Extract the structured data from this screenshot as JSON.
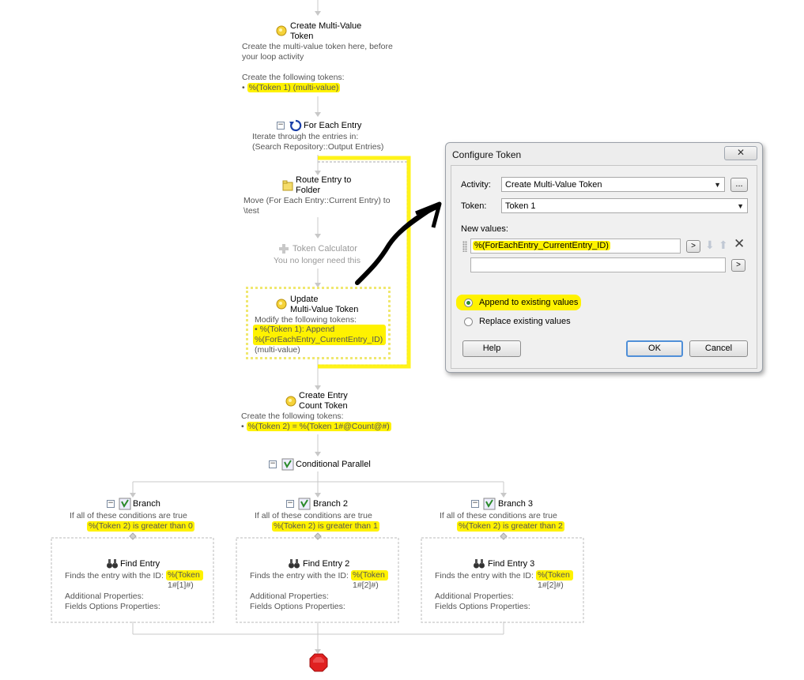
{
  "workflow": {
    "create_multi": {
      "title": "Create Multi-Value\nToken",
      "desc": "Create the multi-value token here, before\nyour loop activity",
      "tokens_label": "Create the following tokens:",
      "token": "%(Token 1) (multi-value)"
    },
    "for_each": {
      "title": "For Each Entry",
      "desc": "Iterate through the entries in:\n(Search Repository::Output Entries)"
    },
    "route_entry": {
      "title": "Route Entry to\nFolder",
      "desc": "Move (For Each Entry::Current Entry) to\n\\test"
    },
    "token_calc": {
      "title": "Token Calculator",
      "desc": "You no longer need this"
    },
    "update_multi": {
      "title": "Update\nMulti-Value Token",
      "desc": "Modify the following tokens:",
      "token": "%(Token 1): Append\n%(ForEachEntry_CurrentEntry_ID)",
      "suffix": "(multi-value)"
    },
    "create_count": {
      "title": "Create Entry\nCount Token",
      "tokens_label": "Create the following tokens:",
      "token": "%(Token 2) = %(Token 1#@Count@#)"
    },
    "conditional": {
      "title": "Conditional Parallel"
    },
    "branches": [
      {
        "title": "Branch",
        "cond_label": "If all of these conditions are true",
        "cond": "%(Token 2) is greater than 0",
        "find_title": "Find Entry",
        "find_desc": "Finds the entry with the ID:",
        "find_id": "%(Token\n1#[1]#)",
        "props1": "Additional Properties:",
        "props2": "Fields Options Properties:"
      },
      {
        "title": "Branch 2",
        "cond_label": "If all of these conditions are true",
        "cond": "%(Token 2) is greater than 1",
        "find_title": "Find Entry 2",
        "find_desc": "Finds the entry with the ID:",
        "find_id": "%(Token\n1#[2]#)",
        "props1": "Additional Properties:",
        "props2": "Fields Options Properties:"
      },
      {
        "title": "Branch 3",
        "cond_label": "If all of these conditions are true",
        "cond": "%(Token 2) is greater than 2",
        "find_title": "Find Entry 3",
        "find_desc": "Finds the entry with the ID:",
        "find_id": "%(Token\n1#[2]#)",
        "props1": "Additional Properties:",
        "props2": "Fields Options Properties:"
      }
    ]
  },
  "dialog": {
    "title": "Configure Token",
    "close": "✕",
    "activity_label": "Activity:",
    "activity_value": "Create Multi-Value Token",
    "browse": "...",
    "token_label": "Token:",
    "token_value": "Token 1",
    "new_values_label": "New values:",
    "value1": "%(ForEachEntry_CurrentEntry_ID)",
    "value2": "",
    "expand": ">",
    "radio_append": "Append to existing values",
    "radio_replace": "Replace existing values",
    "help": "Help",
    "ok": "OK",
    "cancel": "Cancel"
  },
  "colors": {
    "highlight": "#fff200",
    "arrow": "#000000",
    "stop": "#e02020"
  }
}
